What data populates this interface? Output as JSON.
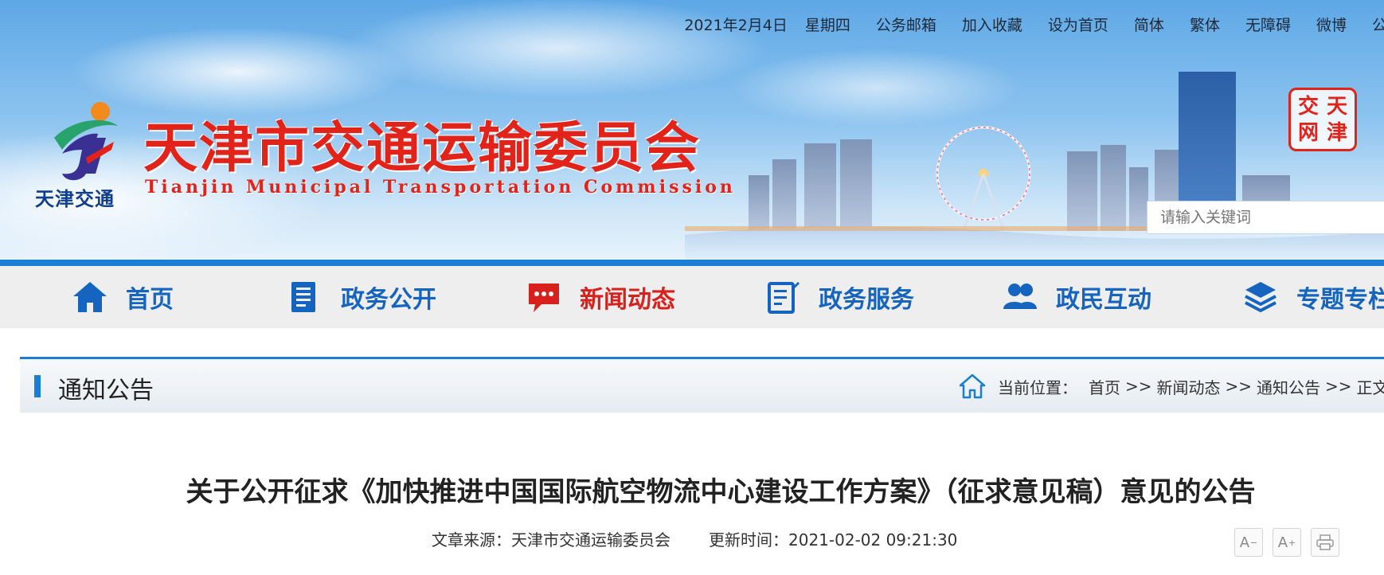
{
  "topbar": {
    "date": "2021年2月4日",
    "weekday": "星期四",
    "links": [
      "公务邮箱",
      "加入收藏",
      "设为首页",
      "简体",
      "繁体",
      "无障碍",
      "微博",
      "公"
    ]
  },
  "header": {
    "logo_caption": "天津交通",
    "title": "天津市交通运输委员会",
    "subtitle": "Tianjin Municipal Transportation Commission",
    "stamp_chars": [
      "交",
      "天",
      "网",
      "津"
    ],
    "search_placeholder": "请输入关键词"
  },
  "nav": {
    "items": [
      {
        "label": "首页",
        "icon": "home-icon"
      },
      {
        "label": "政务公开",
        "icon": "document-icon"
      },
      {
        "label": "新闻动态",
        "icon": "chat-icon",
        "active": true
      },
      {
        "label": "政务服务",
        "icon": "form-icon"
      },
      {
        "label": "政民互动",
        "icon": "people-icon"
      },
      {
        "label": "专题专栏",
        "icon": "layers-icon"
      }
    ]
  },
  "section": {
    "title": "通知公告",
    "breadcrumb_prefix": "当前位置：",
    "breadcrumb": [
      "首页",
      "新闻动态",
      "通知公告",
      "正文"
    ],
    "separator": ">>"
  },
  "article": {
    "title": "关于公开征求《加快推进中国国际航空物流中心建设工作方案》（征求意见稿）意见的公告",
    "source": "文章来源：天津市交通运输委员会",
    "updated": "更新时间：2021-02-02 09:21:30"
  },
  "tools": {
    "font_smaller": "A",
    "font_larger": "A",
    "minus": "−",
    "plus": "+"
  },
  "colors": {
    "brand_blue": "#1a7fd4",
    "nav_text": "#1565c0",
    "active_red": "#d8201c",
    "title_red": "#e2231a"
  }
}
